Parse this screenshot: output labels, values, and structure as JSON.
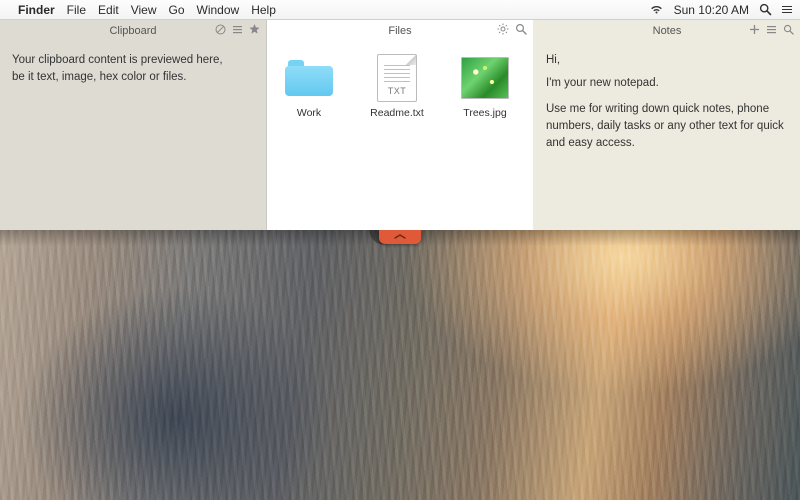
{
  "menubar": {
    "app": "Finder",
    "items": [
      "File",
      "Edit",
      "View",
      "Go",
      "Window",
      "Help"
    ],
    "clock": "Sun 10:20 AM"
  },
  "clipboard": {
    "title": "Clipboard",
    "body": "Your clipboard content is previewed here,\nbe it text, image, hex color or files."
  },
  "files": {
    "title": "Files",
    "items": [
      {
        "name": "Work",
        "kind": "folder"
      },
      {
        "name": "Readme.txt",
        "kind": "txt",
        "badge": "TXT"
      },
      {
        "name": "Trees.jpg",
        "kind": "image"
      }
    ]
  },
  "notes": {
    "title": "Notes",
    "greeting": "Hi,",
    "intro": "I'm your new notepad.",
    "body": "Use me for writing down quick notes, phone numbers, daily tasks or any other text for quick and easy access."
  },
  "colors": {
    "folder": "#6ecff5",
    "handle": "#e05a3a"
  }
}
